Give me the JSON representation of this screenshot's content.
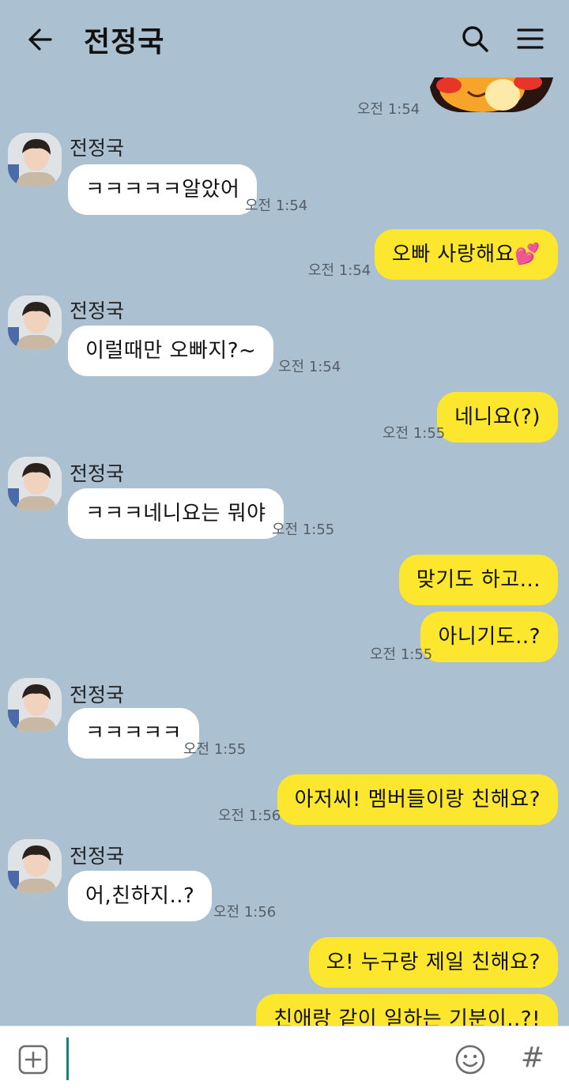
{
  "header": {
    "title": "전정국",
    "back_icon": "arrow-left-icon",
    "search_icon": "search-icon",
    "menu_icon": "hamburger-menu-icon"
  },
  "colors": {
    "background": "#abc1d1",
    "my_bubble": "#fce62e",
    "their_bubble": "#ffffff",
    "caret": "#13857a"
  },
  "messages": [
    {
      "type": "sticker",
      "side": "right",
      "time": "오전 1:54"
    },
    {
      "side": "left",
      "sender": "전정국",
      "text": "ㅋㅋㅋㅋㅋ알았어",
      "time": "오전 1:54"
    },
    {
      "side": "right",
      "text": "오빠 사랑해요💕",
      "time": "오전 1:54"
    },
    {
      "side": "left",
      "sender": "전정국",
      "text": "이럴때만 오빠지?~",
      "time": "오전 1:54"
    },
    {
      "side": "right",
      "text": "네니요(?)",
      "time": "오전 1:55"
    },
    {
      "side": "left",
      "sender": "전정국",
      "text": "ㅋㅋㅋ네니요는 뭐야",
      "time": "오전 1:55"
    },
    {
      "side": "right",
      "text": "맞기도 하고...",
      "time": ""
    },
    {
      "side": "right",
      "text": "아니기도..?",
      "time": "오전 1:55"
    },
    {
      "side": "left",
      "sender": "전정국",
      "text": "ㅋㅋㅋㅋㅋ",
      "time": "오전 1:55"
    },
    {
      "side": "right",
      "text": "아저씨! 멤버들이랑 친해요?",
      "time": "오전 1:56"
    },
    {
      "side": "left",
      "sender": "전정국",
      "text": "어,친하지..?",
      "time": "오전 1:56"
    },
    {
      "side": "right",
      "text": "오! 누구랑 제일 친해요?",
      "time": ""
    },
    {
      "side": "right",
      "text": "친애랑 같이 일하는 기분이..?!",
      "time": ""
    }
  ],
  "input": {
    "value": "",
    "attach_icon": "plus-square-icon",
    "emoji_icon": "smiley-icon",
    "hash_label": "#"
  }
}
